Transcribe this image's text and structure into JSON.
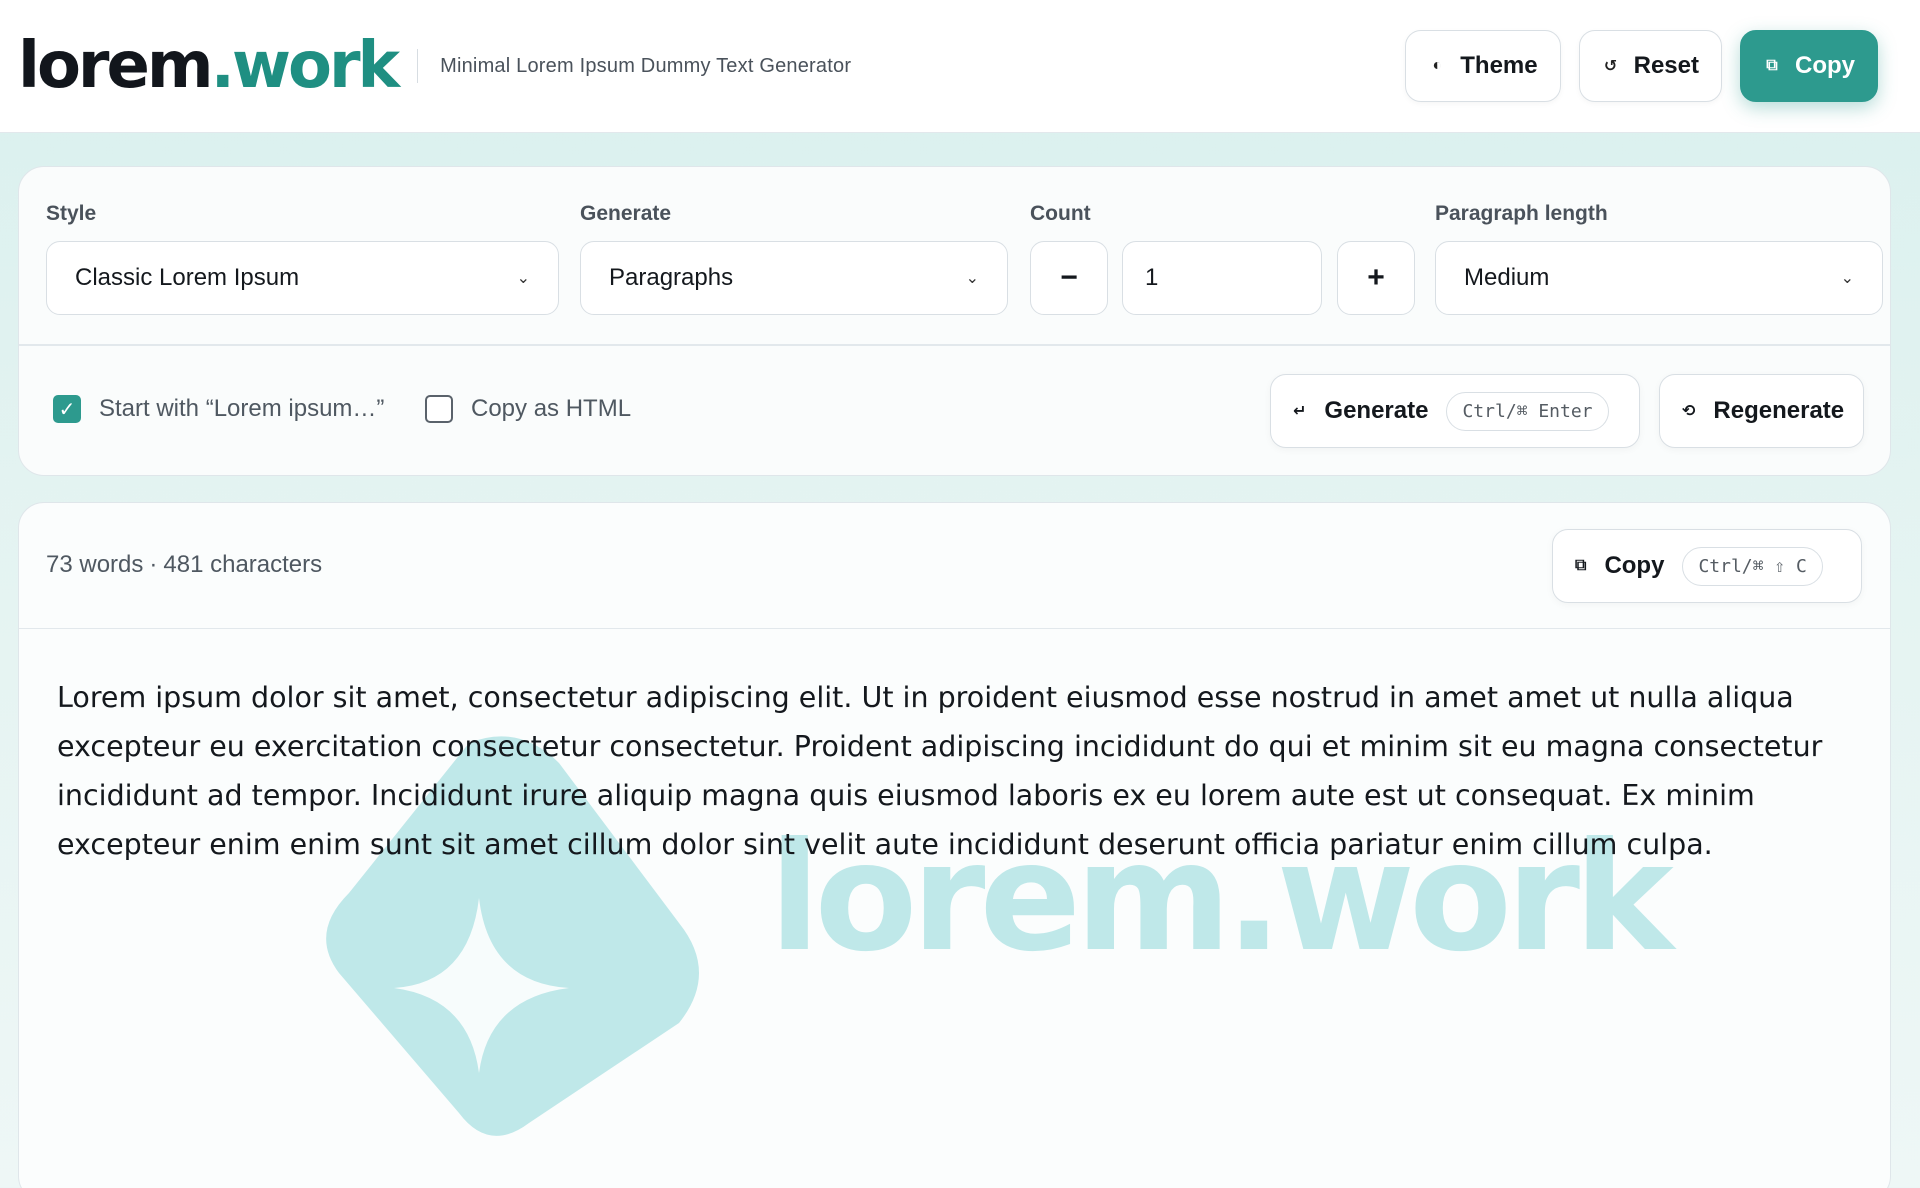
{
  "header": {
    "logo_main": "lorem",
    "logo_accent": ".work",
    "tagline": "Minimal Lorem Ipsum Dummy Text Generator",
    "theme_label": "Theme",
    "reset_label": "Reset",
    "copy_label": "Copy"
  },
  "settings": {
    "style": {
      "label": "Style",
      "value": "Classic Lorem Ipsum"
    },
    "generate": {
      "label": "Generate",
      "value": "Paragraphs"
    },
    "count": {
      "label": "Count",
      "value": "1",
      "minus": "−",
      "plus": "+"
    },
    "paragraph_length": {
      "label": "Paragraph length",
      "value": "Medium"
    },
    "start_with_lorem": {
      "label": "Start with “Lorem ipsum…”",
      "checked": true
    },
    "copy_as_html": {
      "label": "Copy as HTML",
      "checked": false
    },
    "generate_button": {
      "label": "Generate",
      "shortcut": "Ctrl/⌘ Enter"
    },
    "regenerate_button": {
      "label": "Regenerate"
    }
  },
  "output": {
    "words": "73 words",
    "separator": "·",
    "characters": "481 characters",
    "copy_button": {
      "label": "Copy",
      "shortcut": "Ctrl/⌘ ⇧ C"
    },
    "text": "Lorem ipsum dolor sit amet, consectetur adipiscing elit. Ut in proident eiusmod esse nostrud in amet amet ut nulla aliqua excepteur eu exercitation consectetur consectetur. Proident adipiscing incididunt do qui et minim sit eu magna consectetur incididunt ad tempor. Incididunt irure aliquip magna quis eiusmod laboris ex eu lorem aute est ut consequat. Ex minim excepteur enim enim sunt sit amet cillum dolor sint velit aute incididunt deserunt officia pariatur enim cillum culpa.",
    "watermark_text": "lorem.work"
  },
  "colors": {
    "accent": "#2d9a8e",
    "watermark": "#bfe8e9"
  },
  "icons": {
    "theme": "half-circle-icon",
    "reset": "reset-arrow-icon",
    "copy": "copy-icon",
    "generate": "enter-arrow-icon",
    "regenerate": "refresh-icon",
    "select": "chevron-down-icon"
  }
}
